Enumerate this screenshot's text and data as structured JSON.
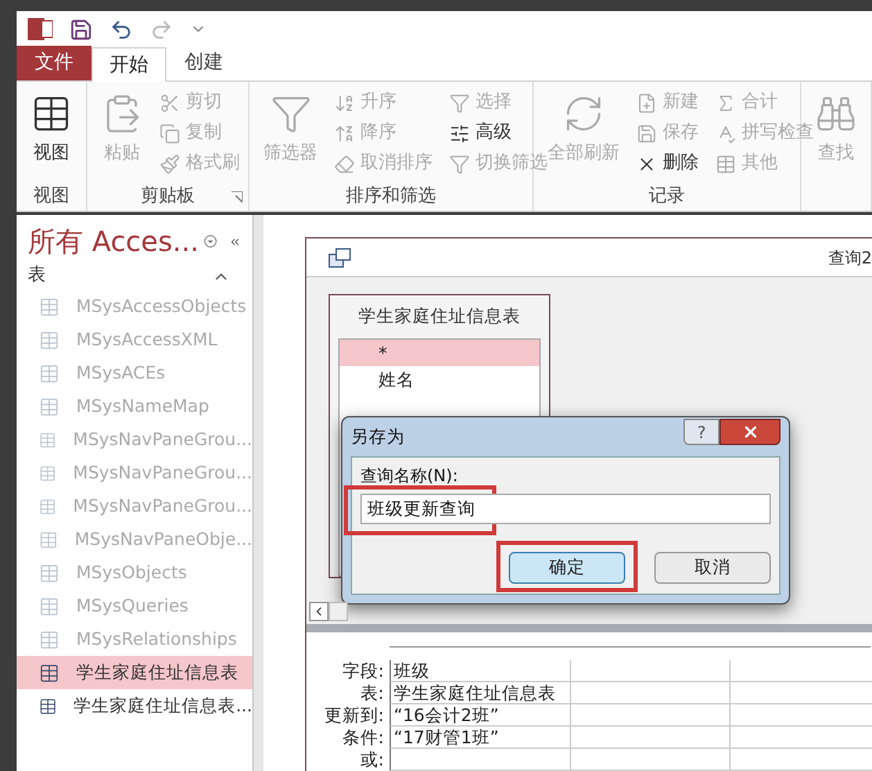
{
  "tabs": [
    {
      "label": "文件",
      "kind": "file",
      "selected": false
    },
    {
      "label": "开始",
      "kind": "tab",
      "selected": true
    },
    {
      "label": "创建",
      "kind": "tab",
      "selected": false
    }
  ],
  "ribbon": [
    {
      "label": "视图",
      "items": [
        {
          "label": "视图",
          "kind": "large",
          "disabled": false
        }
      ]
    },
    {
      "label": "剪贴板",
      "launcher": true,
      "items": [
        {
          "label": "粘贴",
          "kind": "large",
          "disabled": true
        },
        {
          "label": "剪切",
          "kind": "small",
          "disabled": true
        },
        {
          "label": "复制",
          "kind": "small",
          "disabled": true
        },
        {
          "label": "格式刷",
          "kind": "small",
          "disabled": true
        }
      ]
    },
    {
      "label": "排序和筛选",
      "items": [
        {
          "label": "筛选器",
          "kind": "large",
          "disabled": true
        },
        {
          "label": "升序",
          "kind": "small",
          "disabled": true
        },
        {
          "label": "降序",
          "kind": "small",
          "disabled": true
        },
        {
          "label": "取消排序",
          "kind": "small",
          "disabled": true
        },
        {
          "label": "选择",
          "kind": "small",
          "disabled": true
        },
        {
          "label": "高级",
          "kind": "small",
          "disabled": false
        },
        {
          "label": "切换筛选",
          "kind": "small",
          "disabled": true
        }
      ]
    },
    {
      "label": "记录",
      "items": [
        {
          "label": "全部刷新",
          "kind": "large",
          "disabled": true
        },
        {
          "label": "新建",
          "kind": "small",
          "disabled": true
        },
        {
          "label": "保存",
          "kind": "small",
          "disabled": true
        },
        {
          "label": "删除",
          "kind": "small",
          "disabled": false
        },
        {
          "label": "合计",
          "kind": "small",
          "disabled": true
        },
        {
          "label": "拼写检查",
          "kind": "small",
          "disabled": true
        },
        {
          "label": "其他",
          "kind": "small",
          "disabled": true
        }
      ]
    },
    {
      "items": [
        {
          "label": "查找",
          "kind": "large",
          "disabled": true
        }
      ]
    }
  ],
  "nav": {
    "title": "所有 Acces...",
    "section": "表",
    "items": [
      {
        "label": "MSysAccessObjects",
        "dimmed": true,
        "selected": false
      },
      {
        "label": "MSysAccessXML",
        "dimmed": true,
        "selected": false
      },
      {
        "label": "MSysACEs",
        "dimmed": true,
        "selected": false
      },
      {
        "label": "MSysNameMap",
        "dimmed": true,
        "selected": false
      },
      {
        "label": "MSysNavPaneGrou...",
        "dimmed": true,
        "selected": false
      },
      {
        "label": "MSysNavPaneGrou...",
        "dimmed": true,
        "selected": false
      },
      {
        "label": "MSysNavPaneGrou...",
        "dimmed": true,
        "selected": false
      },
      {
        "label": "MSysNavPaneObje...",
        "dimmed": true,
        "selected": false
      },
      {
        "label": "MSysObjects",
        "dimmed": true,
        "selected": false
      },
      {
        "label": "MSysQueries",
        "dimmed": true,
        "selected": false
      },
      {
        "label": "MSysRelationships",
        "dimmed": true,
        "selected": false
      },
      {
        "label": "学生家庭住址信息表",
        "dimmed": false,
        "selected": true
      },
      {
        "label": "学生家庭住址信息表...",
        "dimmed": false,
        "selected": false
      }
    ]
  },
  "query": {
    "title": "查询2",
    "table": {
      "title": "学生家庭住址信息表",
      "fields": [
        {
          "label": "*",
          "selected": true
        },
        {
          "label": "姓名",
          "selected": false
        }
      ]
    },
    "grid": [
      {
        "label": "字段:",
        "cells": [
          "班级"
        ]
      },
      {
        "label": "表:",
        "cells": [
          "学生家庭住址信息表"
        ]
      },
      {
        "label": "更新到:",
        "cells": [
          "“16会计2班”"
        ]
      },
      {
        "label": "条件:",
        "cells": [
          "“17财管1班”"
        ]
      },
      {
        "label": "或:"
      }
    ]
  },
  "dialog": {
    "title": "另存为",
    "help": "?",
    "field_label": "查询名称(N):",
    "value": "班级更新查询",
    "buttons": [
      {
        "label": "确定",
        "default": true
      },
      {
        "label": "取消",
        "default": false
      }
    ]
  }
}
